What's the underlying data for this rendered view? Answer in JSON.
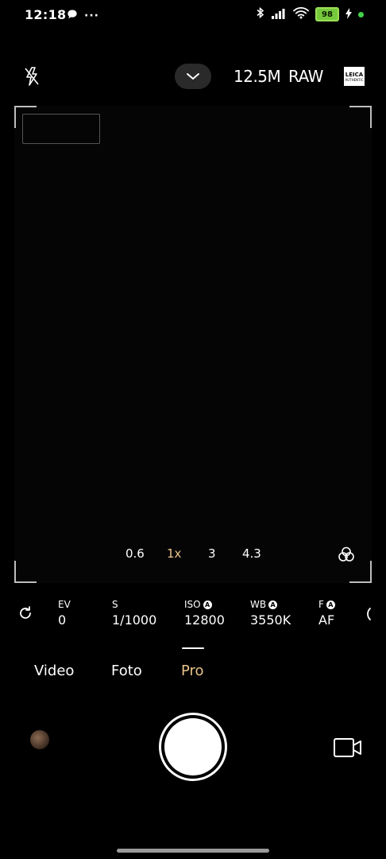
{
  "status_bar": {
    "time": "12:18",
    "more_label": "···",
    "battery": "98",
    "icons": [
      "chat-bubble-icon",
      "bluetooth-icon",
      "signal-icon",
      "wifi-icon",
      "battery-icon",
      "charging-icon"
    ]
  },
  "top_bar": {
    "flash_icon": "flash-off-icon",
    "resolution": "12.5M",
    "format": "RAW",
    "leica_line1": "LEICA",
    "leica_line2": "AUTHENTIC"
  },
  "zoom": {
    "levels": [
      "0.6",
      "1x",
      "3",
      "4.3"
    ],
    "active": "1x"
  },
  "pro_params": {
    "ev_label": "EV",
    "ev_value": "0",
    "s_label": "S",
    "s_value": "1/1000",
    "iso_label": "ISO",
    "iso_value": "12800",
    "wb_label": "WB",
    "wb_value": "3550K",
    "f_label": "F",
    "f_value": "AF",
    "auto_badge": "A"
  },
  "modes": {
    "video": "Video",
    "foto": "Foto",
    "pro": "Pro",
    "active": "Pro"
  },
  "colors": {
    "accent": "#e9c48c",
    "battery": "#77c93c",
    "dot": "#41d24a"
  }
}
